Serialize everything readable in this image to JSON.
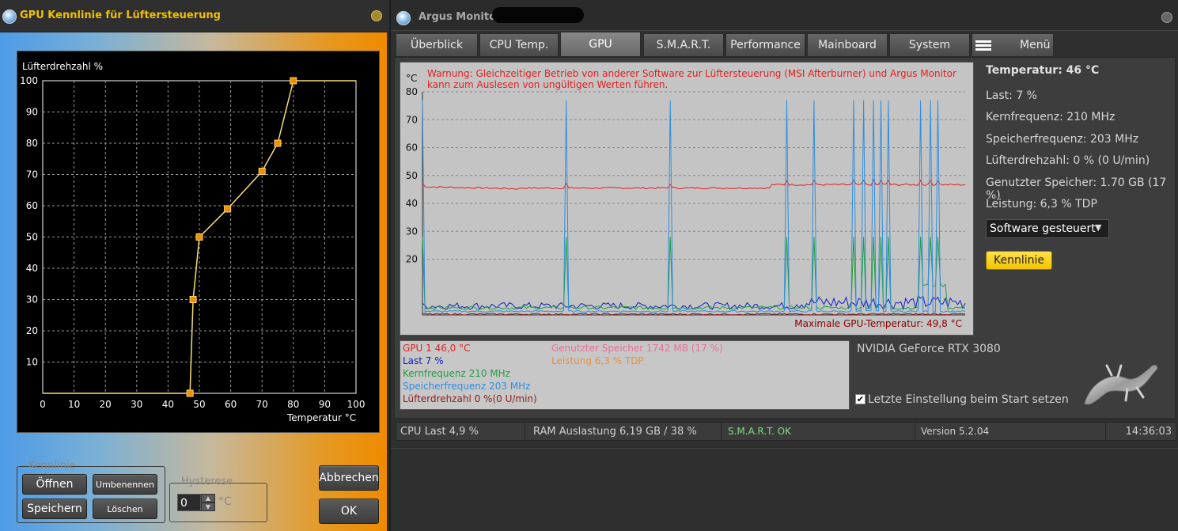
{
  "fan_window": {
    "title": "GPU Kennlinie für Lüftersteuerung",
    "y_axis_label": "Lüfterdrehzahl %",
    "x_axis_label": "Temperatur °C",
    "kennlinie_label": "Kennlinie",
    "buttons": {
      "open": "Öffnen",
      "rename": "Umbenennen",
      "save": "Speichern",
      "delete": "Löschen",
      "cancel": "Abbrechen",
      "ok": "OK"
    },
    "hysterese_label": "Hysterese",
    "hysterese_value": "0",
    "hysterese_unit": "°C"
  },
  "chart_data": [
    {
      "type": "line",
      "ylabel": "Lüfterdrehzahl %",
      "xlabel": "Temperatur °C",
      "xlim": [
        0,
        100
      ],
      "ylim": [
        0,
        100
      ],
      "x_ticks": [
        0,
        10,
        20,
        30,
        40,
        50,
        60,
        70,
        80,
        90,
        100
      ],
      "y_ticks": [
        10,
        20,
        30,
        40,
        50,
        60,
        70,
        80,
        90,
        100
      ],
      "grid": true,
      "points": [
        [
          47,
          0
        ],
        [
          48,
          30
        ],
        [
          50,
          50
        ],
        [
          59,
          59
        ],
        [
          70,
          71
        ],
        [
          75,
          80
        ],
        [
          80,
          100
        ]
      ]
    },
    {
      "type": "line",
      "ylabel": "°C",
      "ylim": [
        0,
        80
      ],
      "y_ticks": [
        20,
        30,
        40,
        50,
        60,
        70,
        80
      ],
      "grid": true,
      "series": [
        {
          "name": "GPU 1 46,0 °C",
          "color": "#e02020",
          "baseline": 45.5
        },
        {
          "name": "Last 7 %",
          "color": "#1020c0",
          "baseline": 2
        },
        {
          "name": "Kernfrequenz 210 MHz",
          "color": "#20a040",
          "baseline": 2,
          "spike": 28
        },
        {
          "name": "Speicherfrequenz 203 MHz",
          "color": "#2f8fe0",
          "baseline": 1,
          "spike": 77
        },
        {
          "name": "Lüfterdrehzahl 0 %(0 U/min)",
          "color": "#8b2020",
          "baseline": 0
        }
      ],
      "spike_positions": [
        0.0,
        0.265,
        0.455,
        0.67,
        0.72,
        0.795,
        0.815,
        0.83,
        0.845,
        0.86,
        0.92,
        0.935,
        0.95
      ]
    }
  ],
  "argus": {
    "title": "Argus Monitor",
    "tabs": [
      "Überblick",
      "CPU Temp.",
      "GPU",
      "S.M.A.R.T.",
      "Performance",
      "Mainboard",
      "System"
    ],
    "menu_label": "Menü",
    "warning": [
      "Warnung: Gleichzeitiger Betrieb von anderer Software zur Lüftersteuerung (MSI Afterburner) und Argus Monitor",
      "kann zum Auslesen von ungültigen Werten führen."
    ],
    "graph_unit": "°C",
    "max_temp": "Maximale GPU-Temperatur: 49,8 °C",
    "legend": {
      "gpu": "GPU 1 46,0 °C",
      "last": "Last 7 %",
      "kern": "Kernfrequenz 210 MHz",
      "speicher": "Speicherfrequenz 203 MHz",
      "luefter": "Lüfterdrehzahl 0 %(0 U/min)",
      "genutzt": "Genutzter Speicher 1742 MB (17 %)",
      "leistung": "Leistung 6,3 % TDP"
    },
    "info": {
      "temperatur": "Temperatur: 46 °C",
      "last": "Last: 7 %",
      "kern": "Kernfrequenz: 210 MHz",
      "speicher": "Speicherfrequenz: 203 MHz",
      "luefter": "Lüfterdrehzahl: 0 % (0 U/min)",
      "genutzt": "Genutzter Speicher: 1.70 GB (17 %)",
      "leistung": "Leistung: 6,3 % TDP"
    },
    "mode_select": "Software gesteuert",
    "kennlinie_button": "Kennlinie",
    "gpu_name": "NVIDIA GeForce RTX 3080",
    "checkbox_label": "Letzte Einstellung beim Start setzen",
    "status": {
      "cpu": "CPU Last 4,9 %",
      "ram": "RAM Auslastung 6,19 GB / 38 %",
      "smart": "S.M.A.R.T. OK",
      "version": "Version 5.2.04",
      "time": "14:36:03"
    },
    "colors": {
      "accent_yellow": "#f5d020",
      "warning_red": "#e02020",
      "smart_ok": "#7ee07e"
    }
  }
}
